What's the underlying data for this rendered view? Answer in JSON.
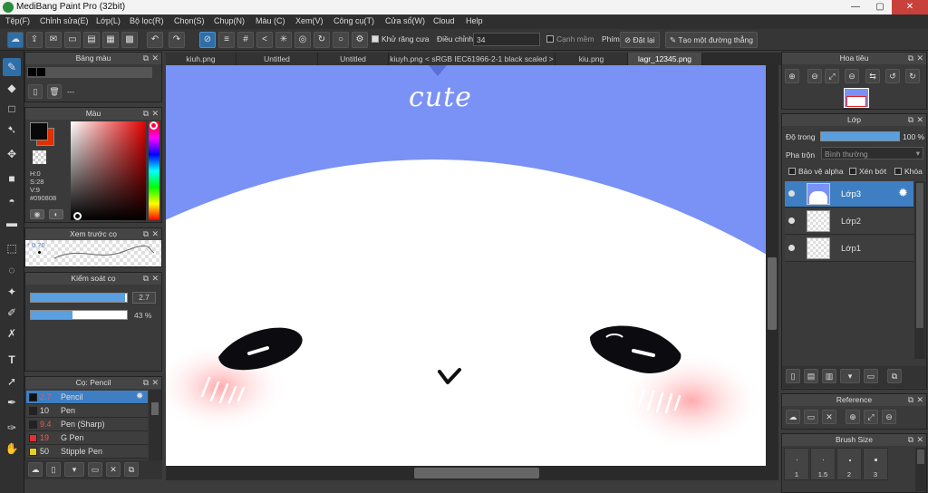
{
  "app": {
    "title": "MediBang Paint Pro (32bit)"
  },
  "window_controls": {
    "minimize": "—",
    "maximize": "▢",
    "close": "✕"
  },
  "menu": [
    "Tệp(F)",
    "Chỉnh sửa(E)",
    "Lớp(L)",
    "Bộ lọc(R)",
    "Chọn(S)",
    "Chụp(N)",
    "Màu (C)",
    "Xem(V)",
    "Công cụ(T)",
    "Cửa sổ(W)",
    "Cloud",
    "Help"
  ],
  "toolbar": {
    "antialias_label": "Khử răng cưa",
    "adjust_label": "Điều chỉnh",
    "adjust_value": "34",
    "edge_label": "Cạnh mềm",
    "key_label": "Phím",
    "reset_label": "Đặt lại",
    "line_label": "Tạo một đường thẳng"
  },
  "tabs": [
    "kiuh.png",
    "Untitled",
    "Untitled",
    "kiuyh.png < sRGB IEC61966-2-1 black scaled >",
    "kiu.png",
    "lagr_12345.png"
  ],
  "active_tab": 5,
  "panels": {
    "palette": {
      "title": "Bảng màu",
      "dash": "---"
    },
    "color": {
      "title": "Màu",
      "h": "H:0",
      "s": "S:28",
      "v": "V:9",
      "hex": "#090808"
    },
    "brush_preview": {
      "title": "Xem trước cọ",
      "size": "0.70"
    },
    "brush_control": {
      "title": "Kiểm soát cọ",
      "size_value": "2.7",
      "opacity_value": "43 %",
      "opacity_fraction": 0.43,
      "size_fraction": 0.98
    },
    "brush": {
      "title": "Cọ: Pencil",
      "items": [
        {
          "size": "2.7",
          "name": "Pencil",
          "color": "#111111",
          "selected": true
        },
        {
          "size": "10",
          "name": "Pen",
          "color": "#222222",
          "selected": false
        },
        {
          "size": "9.4",
          "name": "Pen (Sharp)",
          "color": "#222222",
          "selected": false
        },
        {
          "size": "19",
          "name": "G Pen",
          "color": "#e03030",
          "selected": false
        },
        {
          "size": "50",
          "name": "Stipple Pen",
          "color": "#e8d020",
          "selected": false
        }
      ]
    },
    "navigator": {
      "title": "Hoa tiêu"
    },
    "layer": {
      "title": "Lớp",
      "opacity_label": "Độ trong",
      "opacity_value": "100 %",
      "blend_label": "Pha trộn",
      "blend_value": "Bình thường",
      "protect_alpha": "Bảo vệ alpha",
      "clipping": "Xén bớt",
      "lock": "Khóa",
      "layers": [
        {
          "name": "Lớp3",
          "selected": true
        },
        {
          "name": "Lớp2",
          "selected": false
        },
        {
          "name": "Lớp1",
          "selected": false
        }
      ]
    },
    "reference": {
      "title": "Reference"
    },
    "brush_size": {
      "title": "Brush Size",
      "sizes": [
        "1",
        "1.5",
        "2",
        "3"
      ]
    }
  },
  "canvas": {
    "text": "cute"
  },
  "colors": {
    "accent": "#3e7fc4",
    "canvas_bg": "#7a92f5",
    "foreground": "#090808",
    "background": "#e03000"
  }
}
